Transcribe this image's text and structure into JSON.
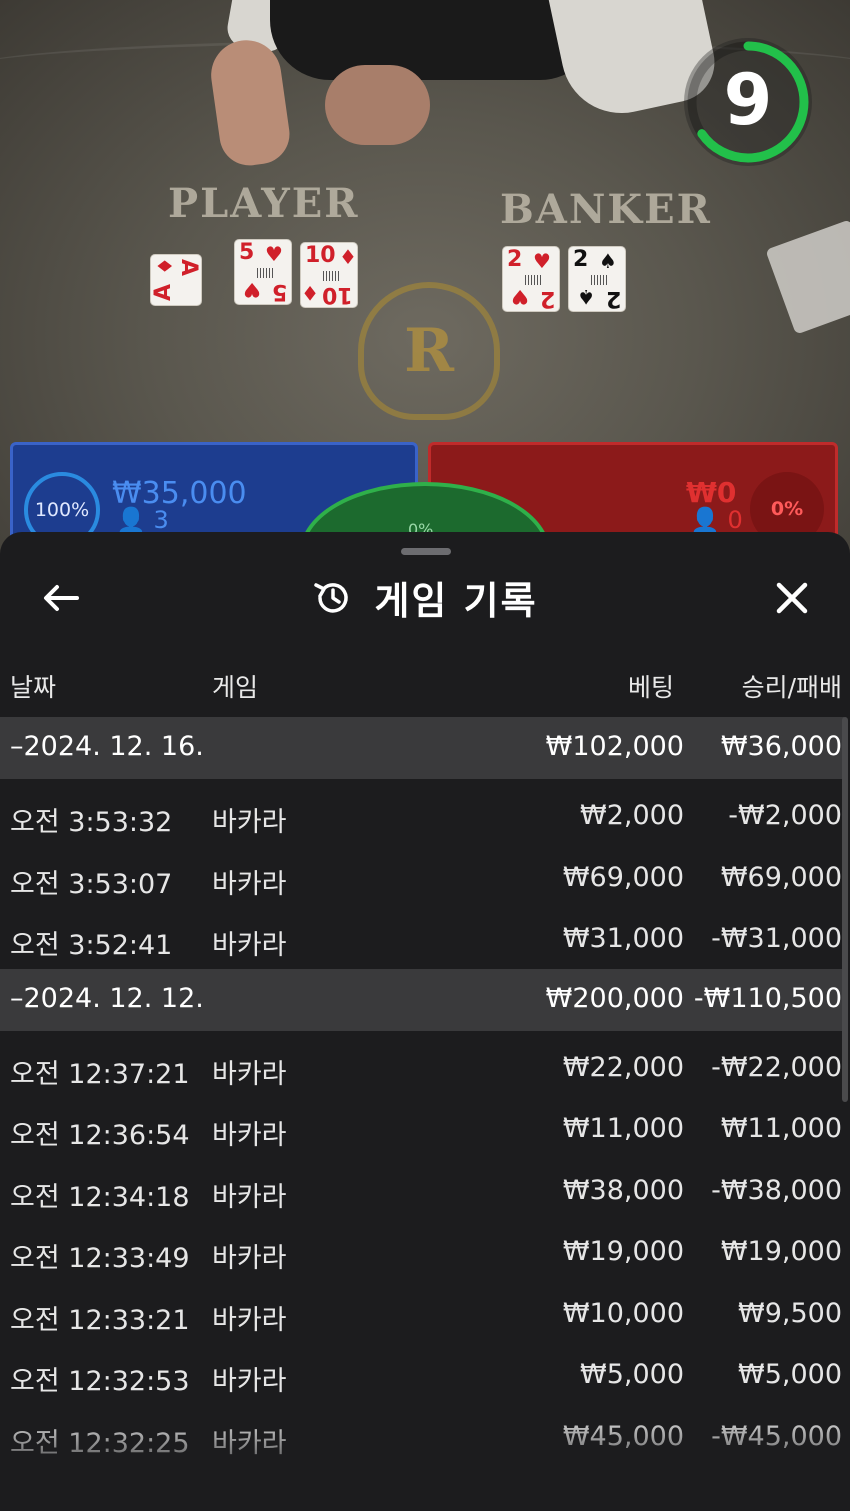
{
  "video": {
    "timer": "9",
    "player_label": "PLAYER",
    "banker_label": "BANKER",
    "logo_letter": "R",
    "player_cards": [
      {
        "rank": "A",
        "suit": "♦",
        "color": "red"
      },
      {
        "rank": "5",
        "suit": "♥",
        "color": "red"
      },
      {
        "rank": "10",
        "suit": "♦",
        "color": "red"
      }
    ],
    "banker_cards": [
      {
        "rank": "2",
        "suit": "♥",
        "color": "red"
      },
      {
        "rank": "2",
        "suit": "♠",
        "color": "black"
      }
    ],
    "player_zone": {
      "percent": "100%",
      "amount": "₩35,000",
      "count": "3"
    },
    "banker_zone": {
      "percent": "0%",
      "amount": "₩0",
      "count": "0"
    },
    "tie_zone": {
      "percent": "0%"
    },
    "colors": {
      "player": "#1d3d8f",
      "banker": "#8c1a1a",
      "tie": "#1c6a2e",
      "timer_ring": "#22c04a"
    }
  },
  "sheet": {
    "title": "게임 기록",
    "icons": {
      "back": "arrow-left-icon",
      "title": "history-icon",
      "close": "close-icon"
    },
    "headers": {
      "date": "날짜",
      "game": "게임",
      "bet": "베팅",
      "result": "승리/패배"
    },
    "groups": [
      {
        "date": "–2024. 12. 16.",
        "bet": "₩102,000",
        "result": "₩36,000",
        "items": [
          {
            "time": "오전 3:53:32",
            "game": "바카라",
            "bet": "₩2,000",
            "result": "-₩2,000"
          },
          {
            "time": "오전 3:53:07",
            "game": "바카라",
            "bet": "₩69,000",
            "result": "₩69,000"
          },
          {
            "time": "오전 3:52:41",
            "game": "바카라",
            "bet": "₩31,000",
            "result": "-₩31,000"
          }
        ]
      },
      {
        "date": "–2024. 12. 12.",
        "bet": "₩200,000",
        "result": "-₩110,500",
        "items": [
          {
            "time": "오전 12:37:21",
            "game": "바카라",
            "bet": "₩22,000",
            "result": "-₩22,000"
          },
          {
            "time": "오전 12:36:54",
            "game": "바카라",
            "bet": "₩11,000",
            "result": "₩11,000"
          },
          {
            "time": "오전 12:34:18",
            "game": "바카라",
            "bet": "₩38,000",
            "result": "-₩38,000"
          },
          {
            "time": "오전 12:33:49",
            "game": "바카라",
            "bet": "₩19,000",
            "result": "₩19,000"
          },
          {
            "time": "오전 12:33:21",
            "game": "바카라",
            "bet": "₩10,000",
            "result": "₩9,500"
          },
          {
            "time": "오전 12:32:53",
            "game": "바카라",
            "bet": "₩5,000",
            "result": "₩5,000"
          },
          {
            "time": "오전 12:32:25",
            "game": "바카라",
            "bet": "₩45,000",
            "result": "-₩45,000"
          }
        ]
      }
    ]
  }
}
